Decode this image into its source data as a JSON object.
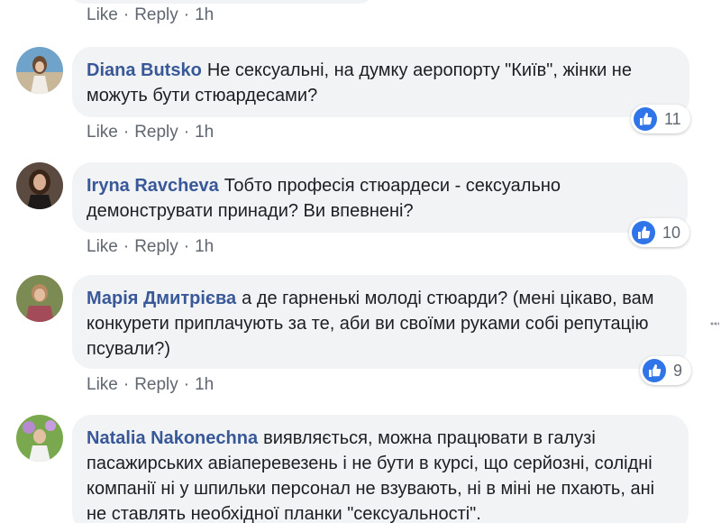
{
  "top": {
    "like": "Like",
    "reply": "Reply",
    "time": "1h",
    "sep": "·"
  },
  "comments": [
    {
      "author": "Diana Butsko",
      "text": "Не сексуальні, на думку аеропорту \"Київ\", жінки не можуть бути стюардесами?",
      "like": "Like",
      "reply": "Reply",
      "time": "1h",
      "sep": "·",
      "reactions": "11"
    },
    {
      "author": "Iryna Ravcheva",
      "text": "Тобто професія стюардеси - сексуально демонструвати принади? Ви впевнені?",
      "like": "Like",
      "reply": "Reply",
      "time": "1h",
      "sep": "·",
      "reactions": "10"
    },
    {
      "author": "Марія Дмитрієва",
      "text": "а де гарненькі молоді стюарди? (мені цікаво, вам конкурети приплачують за те, аби ви своїми руками собі репутацію псували?)",
      "like": "Like",
      "reply": "Reply",
      "time": "1h",
      "sep": "·",
      "reactions": "9"
    },
    {
      "author": "Natalia Nakonechna",
      "text": "виявляється, можна працювати в галузі пасажирських авіаперевезень і не бути в курсі, що серйозні, солідні компанії ні у шпильки персонал не взувають, ні в міні не пхають, ані не ставлять необхідної планки \"сексуальності\"."
    }
  ],
  "colors": {
    "author": "#385898",
    "bubble": "#f2f3f5",
    "meta": "#606770",
    "like_badge": "#2f74e8"
  }
}
